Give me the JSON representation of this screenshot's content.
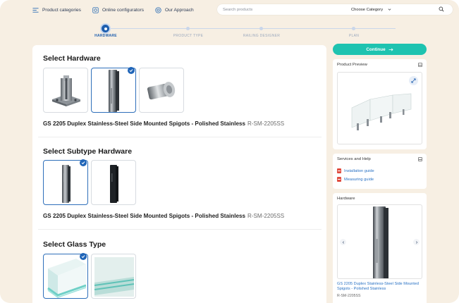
{
  "nav": {
    "items": [
      {
        "label": "Product categories",
        "icon": "menu-icon"
      },
      {
        "label": "Online configurators",
        "icon": "configurator-icon"
      },
      {
        "label": "Our Approach",
        "icon": "approach-icon"
      }
    ],
    "search_placeholder": "Search products",
    "category_select": "Choose Category"
  },
  "stepper": {
    "steps": [
      {
        "label": "HARDWARE",
        "active": true
      },
      {
        "label": "PRODUCT TYPE",
        "active": false
      },
      {
        "label": "RAILING DESIGNER",
        "active": false
      },
      {
        "label": "PLAN",
        "active": false
      }
    ]
  },
  "main": {
    "hardware": {
      "title": "Select Hardware",
      "selected_index": 1,
      "product_name": "GS 2205 Duplex Stainless-Steel Side Mounted Spigots - Polished Stainless",
      "product_code": "R-SM-2205SS"
    },
    "subtype": {
      "title": "Select Subtype Hardware",
      "selected_index": 0,
      "product_name": "GS 2205 Duplex Stainless-Steel Side Mounted Spigots - Polished Stainless",
      "product_code": "R-SM-2205SS"
    },
    "glass": {
      "title": "Select Glass Type",
      "selected_index": 0
    }
  },
  "sidebar": {
    "continue_label": "Continue",
    "preview_title": "Product Preview",
    "services_title": "Services and Help",
    "guides": [
      "Installation guide",
      "Measuring guide"
    ],
    "hardware_title": "Hardware",
    "hardware_name": "GS 2205 Duplex Stainless-Steel Side Mounted Spigots - Polished Stainless",
    "hardware_code": "R-SM-2205SS"
  },
  "colors": {
    "accent": "#1f5fae",
    "continue": "#1ec3b0",
    "background": "#f7efe3",
    "link": "#2a72c4"
  }
}
